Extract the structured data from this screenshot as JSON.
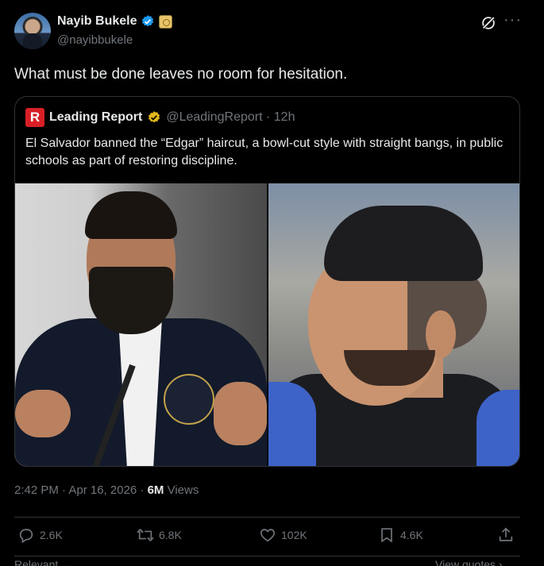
{
  "author": {
    "name": "Nayib Bukele",
    "handle": "@nayibbukele"
  },
  "tweet": {
    "text": "What must be done leaves no room for hesitation."
  },
  "quote": {
    "logo_letter": "R",
    "name": "Leading Report",
    "handle_time": "@LeadingReport · 12h",
    "text": "El Salvador banned the “Edgar” haircut, a bowl-cut style with straight bangs, in public schools as part of restoring discipline."
  },
  "meta": {
    "time_date": "2:42 PM · Apr 16, 2026 · ",
    "views_count": "6M",
    "views_label": " Views"
  },
  "actions": {
    "replies": "2.6K",
    "reposts": "6.8K",
    "likes": "102K",
    "bookmarks": "4.6K"
  },
  "footer": {
    "sort": "Relevant",
    "view_quotes": "View quotes"
  },
  "colors": {
    "background": "#000000",
    "text": "#e7e9ea",
    "muted": "#71767b",
    "verified_blue": "#1d9bf0",
    "verified_gold": "#e2b719",
    "leading_report_red": "#d81f26"
  }
}
